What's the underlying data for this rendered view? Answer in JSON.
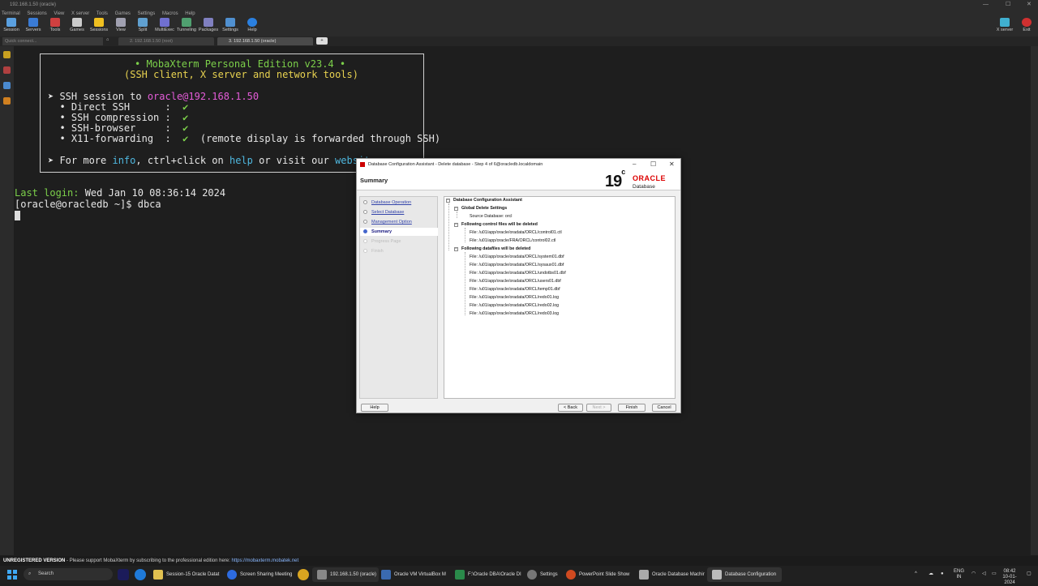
{
  "window": {
    "title": "192.168.1.50 (oracle)"
  },
  "menu": [
    "Terminal",
    "Sessions",
    "View",
    "X server",
    "Tools",
    "Games",
    "Settings",
    "Macros",
    "Help"
  ],
  "toolbar": {
    "buttons": [
      "Session",
      "Servers",
      "Tools",
      "Games",
      "Sessions",
      "View",
      "Split",
      "MultiExec",
      "Tunneling",
      "Packages",
      "Settings",
      "Help"
    ],
    "right": [
      "X server",
      "Exit"
    ]
  },
  "tabs": {
    "quick_connect": "Quick connect...",
    "items": [
      "2. 192.168.1.50 (root)",
      "3. 192.168.1.50 (oracle)"
    ]
  },
  "terminal": {
    "banner_title": "• MobaXterm Personal Edition v23.4 •",
    "banner_sub": "(SSH client, X server and network tools)",
    "ssh_prefix": "➤ SSH session to ",
    "ssh_host": "oracle@192.168.1.50",
    "features": [
      {
        "label": "  • Direct SSH      :  ",
        "mark": "✔"
      },
      {
        "label": "  • SSH compression :  ",
        "mark": "✔"
      },
      {
        "label": "  • SSH-browser     :  ",
        "mark": "✔"
      },
      {
        "label": "  • X11-forwarding  :  ",
        "mark": "✔",
        "note": "  (remote display is forwarded through SSH)"
      }
    ],
    "more_a": "➤ For more ",
    "more_info": "info",
    "more_b": ", ctrl+click on ",
    "more_help": "help",
    "more_c": " or visit our ",
    "more_site": "website",
    "more_d": ".",
    "last_login_label": "Last login:",
    "last_login_value": " Wed Jan 10 08:36:14 2024",
    "prompt": "[oracle@oracledb ~]$ dbca"
  },
  "dialog": {
    "title": "Database Configuration Assistant - Delete database - Step 4 of 6@oracledb.localdomain",
    "header": "Summary",
    "logo_version": "19",
    "logo_version_suffix": "c",
    "logo_brand": "ORACLE",
    "logo_product": "Database",
    "nav": [
      {
        "label": "Database Operation",
        "state": "done"
      },
      {
        "label": "Select Database",
        "state": "done"
      },
      {
        "label": "Management Option",
        "state": "done"
      },
      {
        "label": "Summary",
        "state": "current"
      },
      {
        "label": "Progress Page",
        "state": "disabled"
      },
      {
        "label": "Finish",
        "state": "disabled"
      }
    ],
    "tree": {
      "root": "Database Configuration Assistant",
      "global": "Global Delete Settings",
      "source": "Source Database: orcl",
      "control_header": "Following control files will be deleted",
      "control_files": [
        "File: /u01/app/oracle/oradata/ORCL/control01.ctl",
        "File: /u01/app/oracle/FRA/ORCL/control02.ctl"
      ],
      "data_header": "Following datafiles will be deleted",
      "data_files": [
        "File: /u01/app/oracle/oradata/ORCL/system01.dbf",
        "File: /u01/app/oracle/oradata/ORCL/sysaux01.dbf",
        "File: /u01/app/oracle/oradata/ORCL/undotbs01.dbf",
        "File: /u01/app/oracle/oradata/ORCL/users01.dbf",
        "File: /u01/app/oracle/oradata/ORCL/temp01.dbf",
        "File: /u01/app/oracle/oradata/ORCL/redo01.log",
        "File: /u01/app/oracle/oradata/ORCL/redo02.log",
        "File: /u01/app/oracle/oradata/ORCL/redo03.log"
      ]
    },
    "buttons": {
      "help": "Help",
      "back": "< Back",
      "next": "Next >",
      "finish": "Finish",
      "cancel": "Cancel"
    }
  },
  "status": {
    "unregistered": "UNREGISTERED VERSION",
    "message": "  -  Please support MobaXterm by subscribing to the professional edition here:  ",
    "link": "https://mobaxterm.mobatek.net"
  },
  "taskbar": {
    "search": "Search",
    "items": [
      "Session-15 Oracle Datat",
      "Screen Sharing Meeting",
      "192.168.1.50 (oracle)",
      "Oracle VM VirtualBox M",
      "F:\\Oracle DBA\\Oracle DI",
      "Settings",
      "PowerPoint Slide Show",
      "Oracle Database Machir",
      "Database Configuration"
    ],
    "lang_top": "ENG",
    "lang_bottom": "IN",
    "time": "08:42",
    "date": "10-01-2024"
  },
  "colors": {
    "accent_green": "#7cd04a",
    "accent_yellow": "#e8d250",
    "accent_magenta": "#e45cd8",
    "link_cyan": "#4fb8e0",
    "oracle_red": "#dd0000"
  }
}
